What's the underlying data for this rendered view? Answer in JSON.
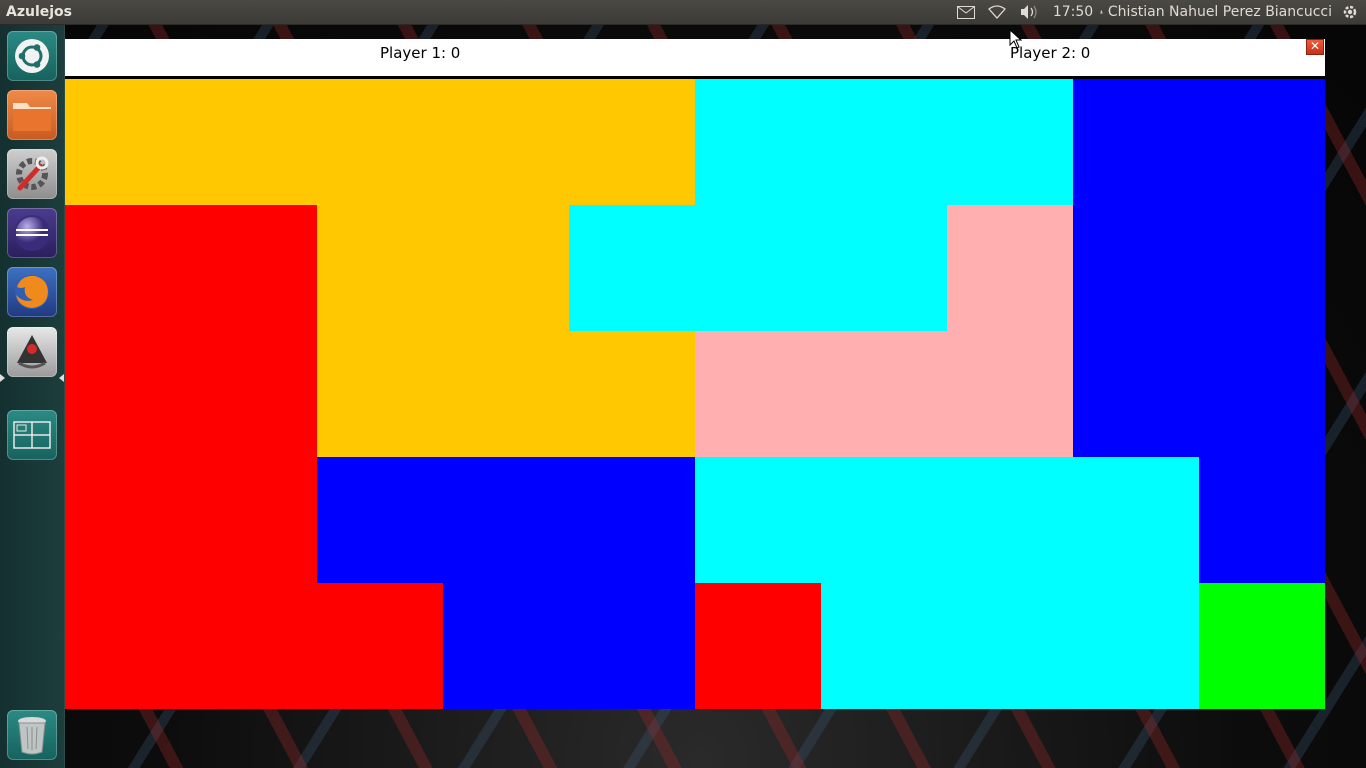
{
  "top_panel": {
    "app_title": "Azulejos",
    "clock": "17:50",
    "user": "Chistian Nahuel Perez Biancucci",
    "icons": [
      "mail-icon",
      "wifi-icon",
      "volume-icon",
      "user-icon",
      "session-gear-icon"
    ]
  },
  "launcher": {
    "items": [
      {
        "name": "dash-button",
        "icon": "ubuntu-logo-icon"
      },
      {
        "name": "files-launcher",
        "icon": "folder-icon"
      },
      {
        "name": "settings-launcher",
        "icon": "system-settings-icon"
      },
      {
        "name": "eclipse-launcher",
        "icon": "eclipse-icon"
      },
      {
        "name": "firefox-launcher",
        "icon": "firefox-icon"
      },
      {
        "name": "java-launcher",
        "icon": "java-app-icon"
      },
      {
        "name": "workspace-launcher",
        "icon": "workspace-switcher-icon"
      },
      {
        "name": "trash-launcher",
        "icon": "trash-icon"
      }
    ]
  },
  "game": {
    "player1_score": "Player 1: 0",
    "player2_score": "Player 2: 0",
    "close_symbol": "✕",
    "colors": {
      "Y": "#ffc800",
      "C": "#00ffff",
      "B": "#0000ff",
      "R": "#ff0000",
      "P": "#ffafaf",
      "G": "#00ff00"
    },
    "grid": [
      [
        "Y",
        "Y",
        "Y",
        "Y",
        "Y",
        "C",
        "C",
        "C",
        "B",
        "B"
      ],
      [
        "R",
        "R",
        "Y",
        "Y",
        "C",
        "C",
        "C",
        "P",
        "B",
        "B"
      ],
      [
        "R",
        "R",
        "Y",
        "Y",
        "Y",
        "P",
        "P",
        "P",
        "B",
        "B"
      ],
      [
        "R",
        "R",
        "B",
        "B",
        "B",
        "C",
        "C",
        "C",
        "C",
        "B"
      ],
      [
        "R",
        "R",
        "R",
        "B",
        "B",
        "R",
        "C",
        "C",
        "C",
        "G"
      ]
    ]
  }
}
